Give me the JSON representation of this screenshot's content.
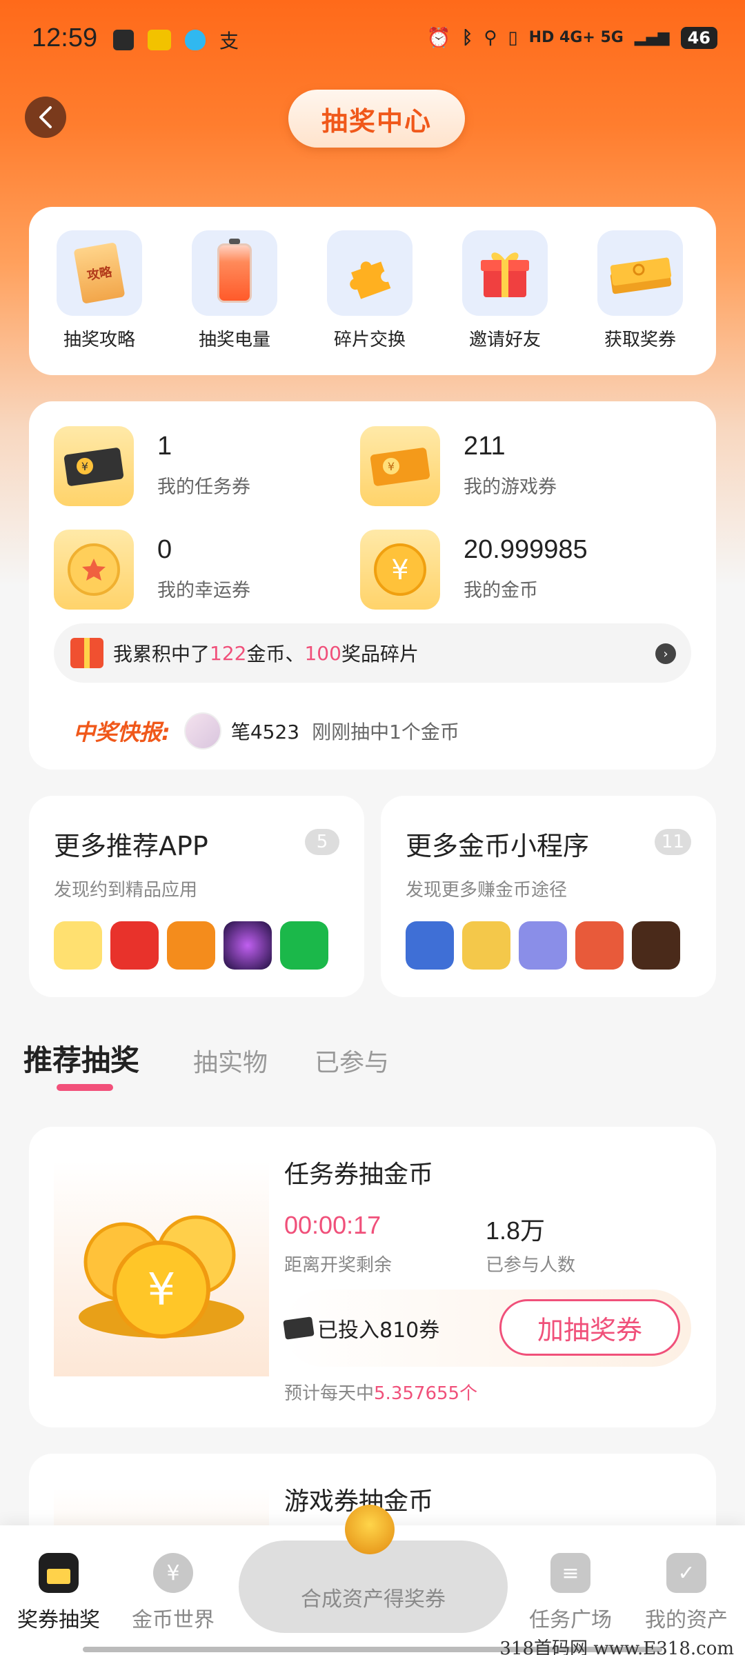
{
  "status_bar": {
    "time": "12:59",
    "network": "HD 4G+ 5G",
    "battery": "46"
  },
  "header": {
    "title": "抽奖中心"
  },
  "quick_actions": [
    {
      "label": "抽奖攻略",
      "icon": "guide-book-icon",
      "icon_text": "攻略"
    },
    {
      "label": "抽奖电量",
      "icon": "battery-icon"
    },
    {
      "label": "碎片交换",
      "icon": "puzzle-piece-icon"
    },
    {
      "label": "邀请好友",
      "icon": "gift-box-icon"
    },
    {
      "label": "获取奖券",
      "icon": "tickets-icon"
    }
  ],
  "assets": [
    {
      "value": "1",
      "label": "我的任务券",
      "icon": "task-ticket-icon"
    },
    {
      "value": "211",
      "label": "我的游戏券",
      "icon": "game-ticket-icon"
    },
    {
      "value": "0",
      "label": "我的幸运券",
      "icon": "lucky-coin-icon"
    },
    {
      "value": "20.999985",
      "label": "我的金币",
      "icon": "gold-coin-icon"
    }
  ],
  "accumulated": {
    "prefix": "我累积中了",
    "coins": "122",
    "coins_unit": "金币、",
    "fragments": "100",
    "fragments_unit": "奖品碎片"
  },
  "news": {
    "label": "中奖快报:",
    "user": "笔4523",
    "text": "刚刚抽中1个金币"
  },
  "more_apps": {
    "title": "更多推荐APP",
    "badge": "5",
    "subtitle": "发现约到精品应用",
    "icon_colors": [
      "#4aa3f0",
      "#e8322b",
      "#f48c1c",
      "#3a2a6a",
      "#1bb84a"
    ]
  },
  "more_miniprograms": {
    "title": "更多金币小程序",
    "badge": "11",
    "subtitle": "发现更多赚金币途径",
    "icon_colors": [
      "#3f6fd6",
      "#f4c84a",
      "#8a8ee8",
      "#e85a3a",
      "#4a2a1a"
    ]
  },
  "tabs": [
    {
      "label": "推荐抽奖",
      "active": true
    },
    {
      "label": "抽实物",
      "active": false
    },
    {
      "label": "已参与",
      "active": false
    }
  ],
  "lotteries": [
    {
      "title": "任务券抽金币",
      "timer": "00:00:17",
      "timer_label": "距离开奖剩余",
      "participants": "1.8万",
      "participants_label": "已参与人数",
      "invested": "已投入810券",
      "button": "加抽奖券",
      "estimate_prefix": "预计每天中",
      "estimate_value": "5.357655个"
    },
    {
      "title": "游戏券抽金币"
    }
  ],
  "bottom_nav": {
    "items": [
      {
        "label": "奖券抽奖",
        "active": true
      },
      {
        "label": "金币世界",
        "active": false
      },
      {
        "label": "任务广场",
        "active": false
      },
      {
        "label": "我的资产",
        "active": false
      }
    ],
    "center_button": "合成资产得奖券"
  },
  "watermark": "318首码网 www.E318.com",
  "colors": {
    "accent": "#f0581a",
    "pink": "#f0507a",
    "gold": "#ffc53a"
  }
}
